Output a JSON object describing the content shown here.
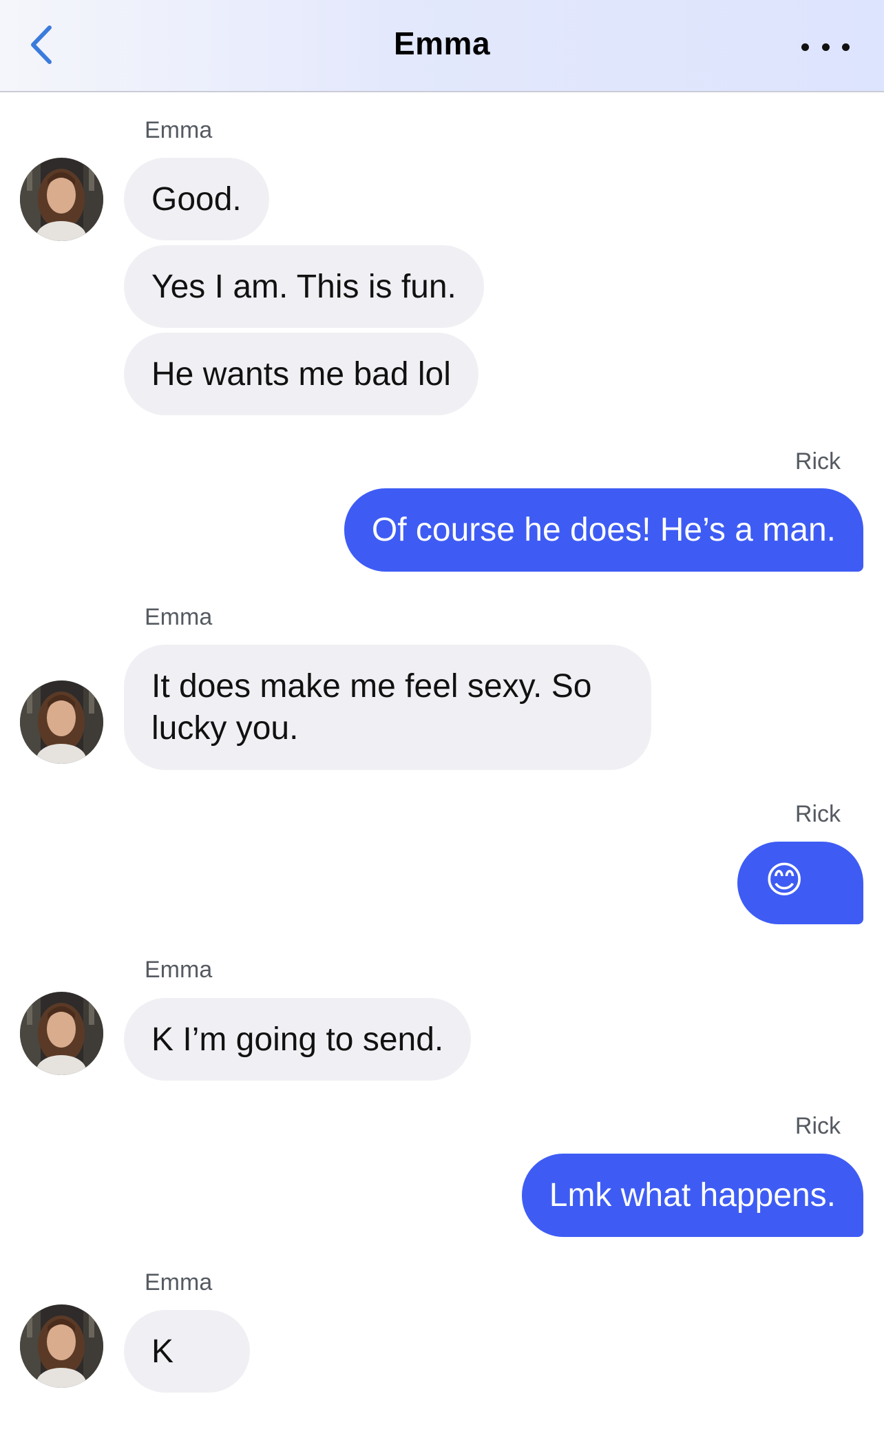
{
  "header": {
    "title": "Emma",
    "back_icon": "chevron-left-icon",
    "more_icon": "more-dots-icon",
    "accent_color": "#3b7bdc"
  },
  "colors": {
    "outgoing_bubble": "#3e5cf4",
    "incoming_bubble": "#f0f0f4"
  },
  "messages": [
    {
      "sender": "Emma",
      "texts": [
        "Good.",
        "Yes I am. This is fun.",
        "He wants me bad lol"
      ]
    },
    {
      "sender": "Rick",
      "texts": [
        "Of course he does! He’s a man."
      ]
    },
    {
      "sender": "Emma",
      "texts": [
        "It does make me feel sexy. So lucky you."
      ]
    },
    {
      "sender": "Rick",
      "texts": [
        "😊"
      ]
    },
    {
      "sender": "Emma",
      "texts": [
        "K I’m going to send."
      ]
    },
    {
      "sender": "Rick",
      "texts": [
        "Lmk what happens."
      ]
    },
    {
      "sender": "Emma",
      "texts": [
        "K"
      ]
    }
  ]
}
